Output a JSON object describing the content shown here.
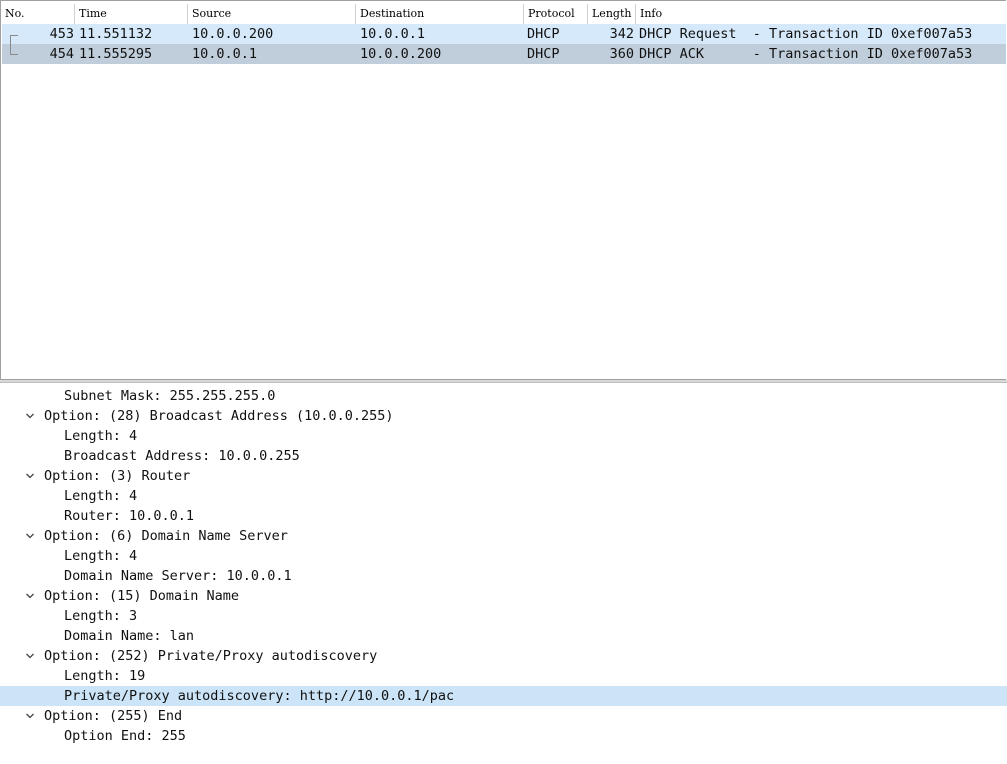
{
  "packet_list": {
    "columns": [
      "No.",
      "Time",
      "Source",
      "Destination",
      "Protocol",
      "Length",
      "Info"
    ],
    "rows": [
      {
        "no": "453",
        "time": "11.551132",
        "source": "10.0.0.200",
        "destination": "10.0.0.1",
        "protocol": "DHCP",
        "length": "342",
        "info": "DHCP Request  - Transaction ID 0xef007a53"
      },
      {
        "no": "454",
        "time": "11.555295",
        "source": "10.0.0.1",
        "destination": "10.0.0.200",
        "protocol": "DHCP",
        "length": "360",
        "info": "DHCP ACK      - Transaction ID 0xef007a53"
      }
    ]
  },
  "details": {
    "lines": [
      "Subnet Mask: 255.255.255.0",
      "Option: (28) Broadcast Address (10.0.0.255)",
      "Length: 4",
      "Broadcast Address: 10.0.0.255",
      "Option: (3) Router",
      "Length: 4",
      "Router: 10.0.0.1",
      "Option: (6) Domain Name Server",
      "Length: 4",
      "Domain Name Server: 10.0.0.1",
      "Option: (15) Domain Name",
      "Length: 3",
      "Domain Name: lan",
      "Option: (252) Private/Proxy autodiscovery",
      "Length: 19",
      "Private/Proxy autodiscovery: http://10.0.0.1/pac",
      "Option: (255) End",
      "Option End: 255"
    ]
  },
  "colors": {
    "row_request": "#d6e9fa",
    "row_selected": "#c0cedb",
    "detail_selected": "#cce4f7"
  },
  "icons": {
    "expand": "chevron-down-icon",
    "conversation": "conversation-bracket-icon"
  }
}
